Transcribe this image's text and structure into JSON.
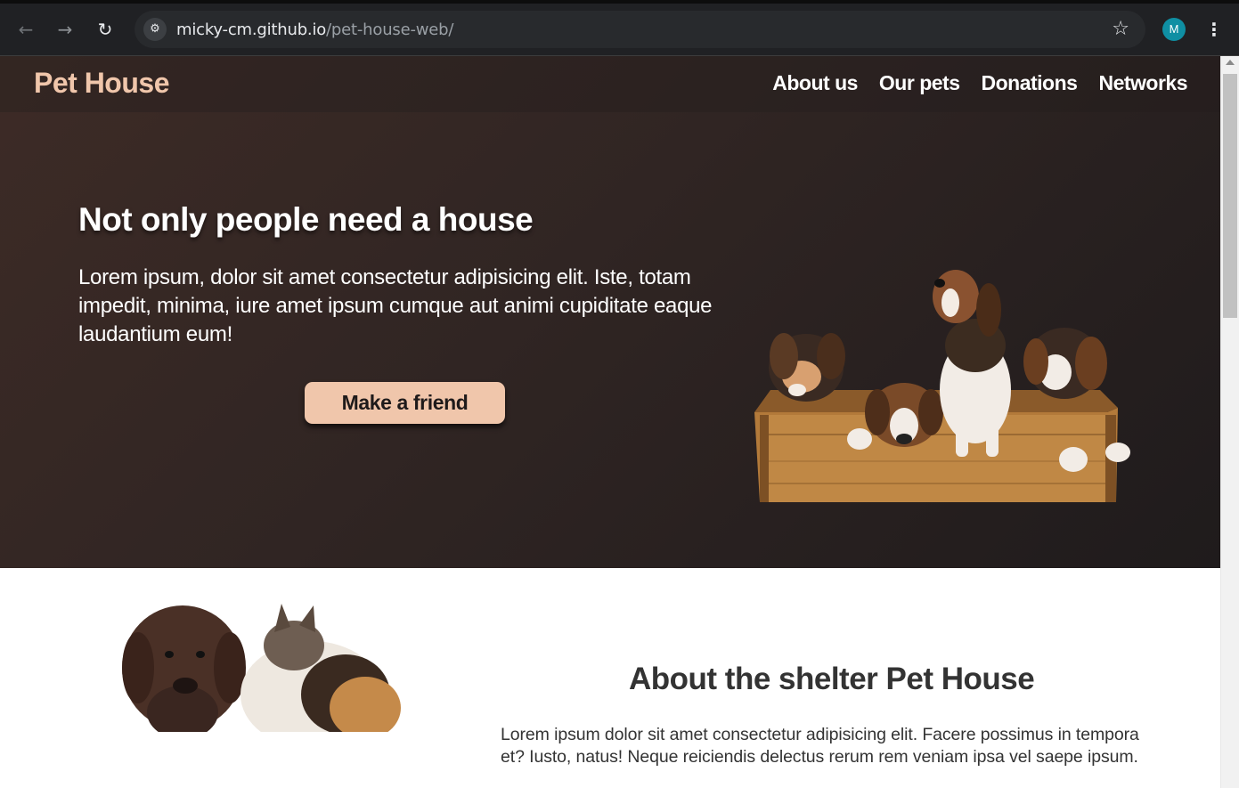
{
  "browser": {
    "url_host": "micky-cm.github.io",
    "url_path": "/pet-house-web/",
    "profile_initial": "M",
    "icons": [
      "back-arrow-icon",
      "forward-arrow-icon",
      "reload-icon",
      "site-info-icon",
      "bookmark-star-icon",
      "kebab-menu-icon"
    ]
  },
  "site": {
    "logo": "Pet House",
    "nav": [
      "About us",
      "Our pets",
      "Donations",
      "Networks"
    ]
  },
  "hero": {
    "title": "Not only people need a house",
    "text": "Lorem ipsum, dolor sit amet consectetur adipisicing elit. Iste, totam impedit, minima, iure amet ipsum cumque aut animi cupiditate eaque laudantium eum!",
    "cta": "Make a friend"
  },
  "about": {
    "title": "About the shelter Pet House",
    "text": "Lorem ipsum dolor sit amet consectetur adipisicing elit. Facere possimus in tempora et? Iusto, natus! Neque reiciendis delectus rerum rem veniam ipsa vel saepe ipsum."
  },
  "colors": {
    "accent": "#f0c6ab",
    "hero_dark": "#302523",
    "text_dark": "#333333",
    "chrome_bg": "#202124"
  }
}
